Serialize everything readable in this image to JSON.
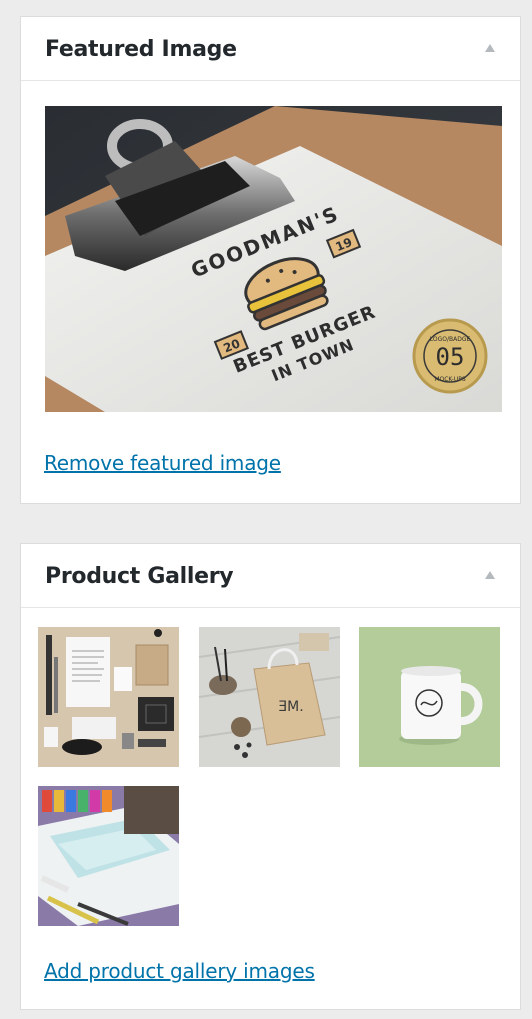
{
  "featured_image": {
    "title": "Featured Image",
    "image_alt": "Clipboard logo mockup",
    "logo_text": {
      "brand": "GOODMAN'S",
      "slogan_line1": "BEST BURGER",
      "slogan_line2": "IN TOWN",
      "year_left": "20",
      "year_right": "19",
      "badge_top": "LOGO/BADGE",
      "badge_number": "05",
      "badge_bottom": "MOCK-UPS"
    },
    "remove_link": "Remove featured image"
  },
  "product_gallery": {
    "title": "Product Gallery",
    "images": [
      {
        "alt": "Stationery flat lay"
      },
      {
        "alt": "Paper bag with EM logo",
        "logo": "ƎM."
      },
      {
        "alt": "White mug on green background"
      },
      {
        "alt": "Art supplies flat lay"
      }
    ],
    "add_link": "Add product gallery images"
  },
  "colors": {
    "link": "#0073aa",
    "panel_bg": "#ffffff",
    "page_bg": "#ececec",
    "border": "#dcdcdc"
  },
  "icons": {
    "toggle": "triangle-up-icon"
  }
}
